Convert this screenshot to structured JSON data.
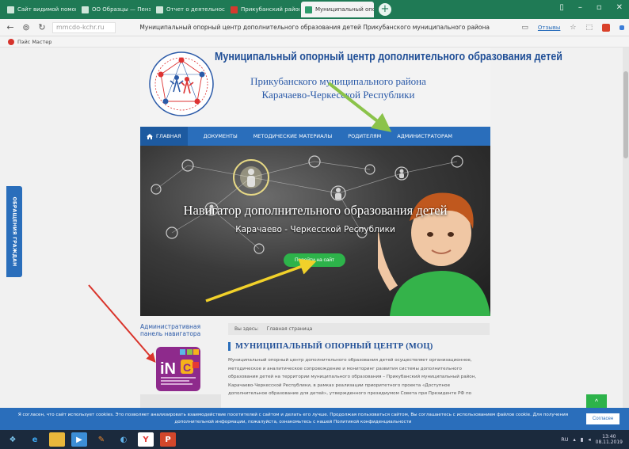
{
  "browser": {
    "tabs": [
      {
        "label": "Сайт видимой помощник",
        "active": false
      },
      {
        "label": "ОО Образцы — Пенза М",
        "active": false
      },
      {
        "label": "Отчет о деятельности М",
        "active": false
      },
      {
        "label": "Прикубанский районный",
        "active": false
      },
      {
        "label": "Муниципальный опор",
        "active": true
      }
    ],
    "new_tab": "+",
    "url": "mmcdo-kchr.ru",
    "page_title": "Муниципальный опорный центр дополнительного образования детей Прикубанского муниципального района",
    "reviews_label": "Отзывы",
    "bookmark": "Пэйс Мастер"
  },
  "site": {
    "title": "Муниципальный опорный центр дополнительного образования детей",
    "subtitle_line1": "Прикубанского муниципального района",
    "subtitle_line2": "Карачаево-Черкесской Республики",
    "side_tab": "ОБРАЩЕНИЯ ГРАЖДАН",
    "menu": [
      {
        "label": "ГЛАВНАЯ"
      },
      {
        "label": "ДОКУМЕНТЫ"
      },
      {
        "label": "МЕТОДИЧЕСКИЕ МАТЕРИАЛЫ"
      },
      {
        "label": "РОДИТЕЛЯМ"
      },
      {
        "label": "АДМИНИСТРАТОРАМ"
      }
    ],
    "hero": {
      "title": "Навигатор дополнительного образования детей",
      "subtitle": "Карачаево - Черкесской Республики",
      "button": "Перейти на сайт"
    },
    "admin_heading": "Административная панель навигатора",
    "admin_sub": "панель навигатора",
    "crumbs": [
      "Вы здесь:",
      "Главная страница"
    ],
    "section_title": "МУНИЦИПАЛЬНЫЙ ОПОРНЫЙ ЦЕНТР (МОЦ)",
    "body_text": "Муниципальный опорный центр дополнительного образования детей осуществляет организационное, методическое и аналитическое сопровождение и мониторинг развития системы дополнительного образования детей на территории муниципального образования – Прикубанский муниципальный район, Карачаево-Черкесской Республики, в рамках реализации приоритетного проекта «Доступное дополнительное образование для детей», утвержденного президиумом Совета при Президенте РФ по"
  },
  "cookie": {
    "text": "Я согласен, что сайт использует cookies. Это позволяет анализировать взаимодействие посетителей с сайтом и делать его лучше. Продолжая пользоваться сайтом, Вы соглашаетесь с использованием файлов cookie. Для получения дополнительной информации, пожалуйста, ознакомьтесь с нашей Политикой конфиденциальности",
    "button": "Согласен"
  },
  "to_top": "^",
  "taskbar": {
    "lang": "RU",
    "time": "13:40",
    "date": "08.11.2019"
  },
  "colors": {
    "menu_blue": "#2a6ebb",
    "title_blue": "#1f4e96",
    "tab_green": "#1f7a55",
    "button_green": "#2db34a",
    "arrow_green": "#8bc34a",
    "arrow_yellow": "#f1d12a",
    "arrow_red": "#d9342b"
  }
}
